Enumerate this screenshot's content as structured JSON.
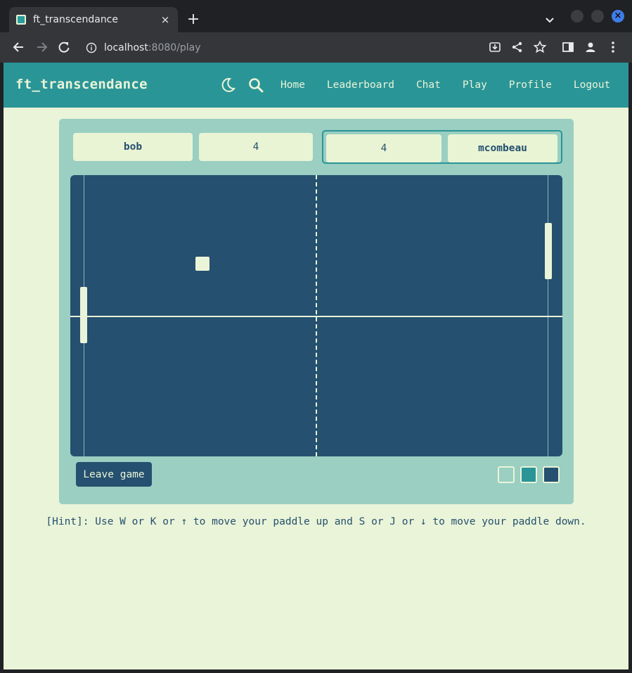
{
  "browser": {
    "tab_title": "ft_transcendance",
    "tab_close": "×",
    "new_tab": "+",
    "url_host": "localhost",
    "url_path": ":8080/play",
    "window_close": "×"
  },
  "navbar": {
    "brand": "ft_transcendance",
    "links": [
      "Home",
      "Leaderboard",
      "Chat",
      "Play",
      "Profile",
      "Logout"
    ]
  },
  "scoreboard": {
    "player1": {
      "name": "bob",
      "score": "4"
    },
    "player2": {
      "name": "mcombeau",
      "score": "4"
    }
  },
  "game": {
    "colors": {
      "field": "#25506f",
      "paddle": "#eaf4d8",
      "ball": "#eaf4d8",
      "card": "#9acfc2"
    }
  },
  "controls": {
    "leave_label": "Leave game",
    "themes": [
      "#eaf4d8",
      "#2a9597",
      "#25506f"
    ]
  },
  "hint": "[Hint]: Use W or K or ↑ to move your paddle up and S or J or ↓ to move your paddle down."
}
